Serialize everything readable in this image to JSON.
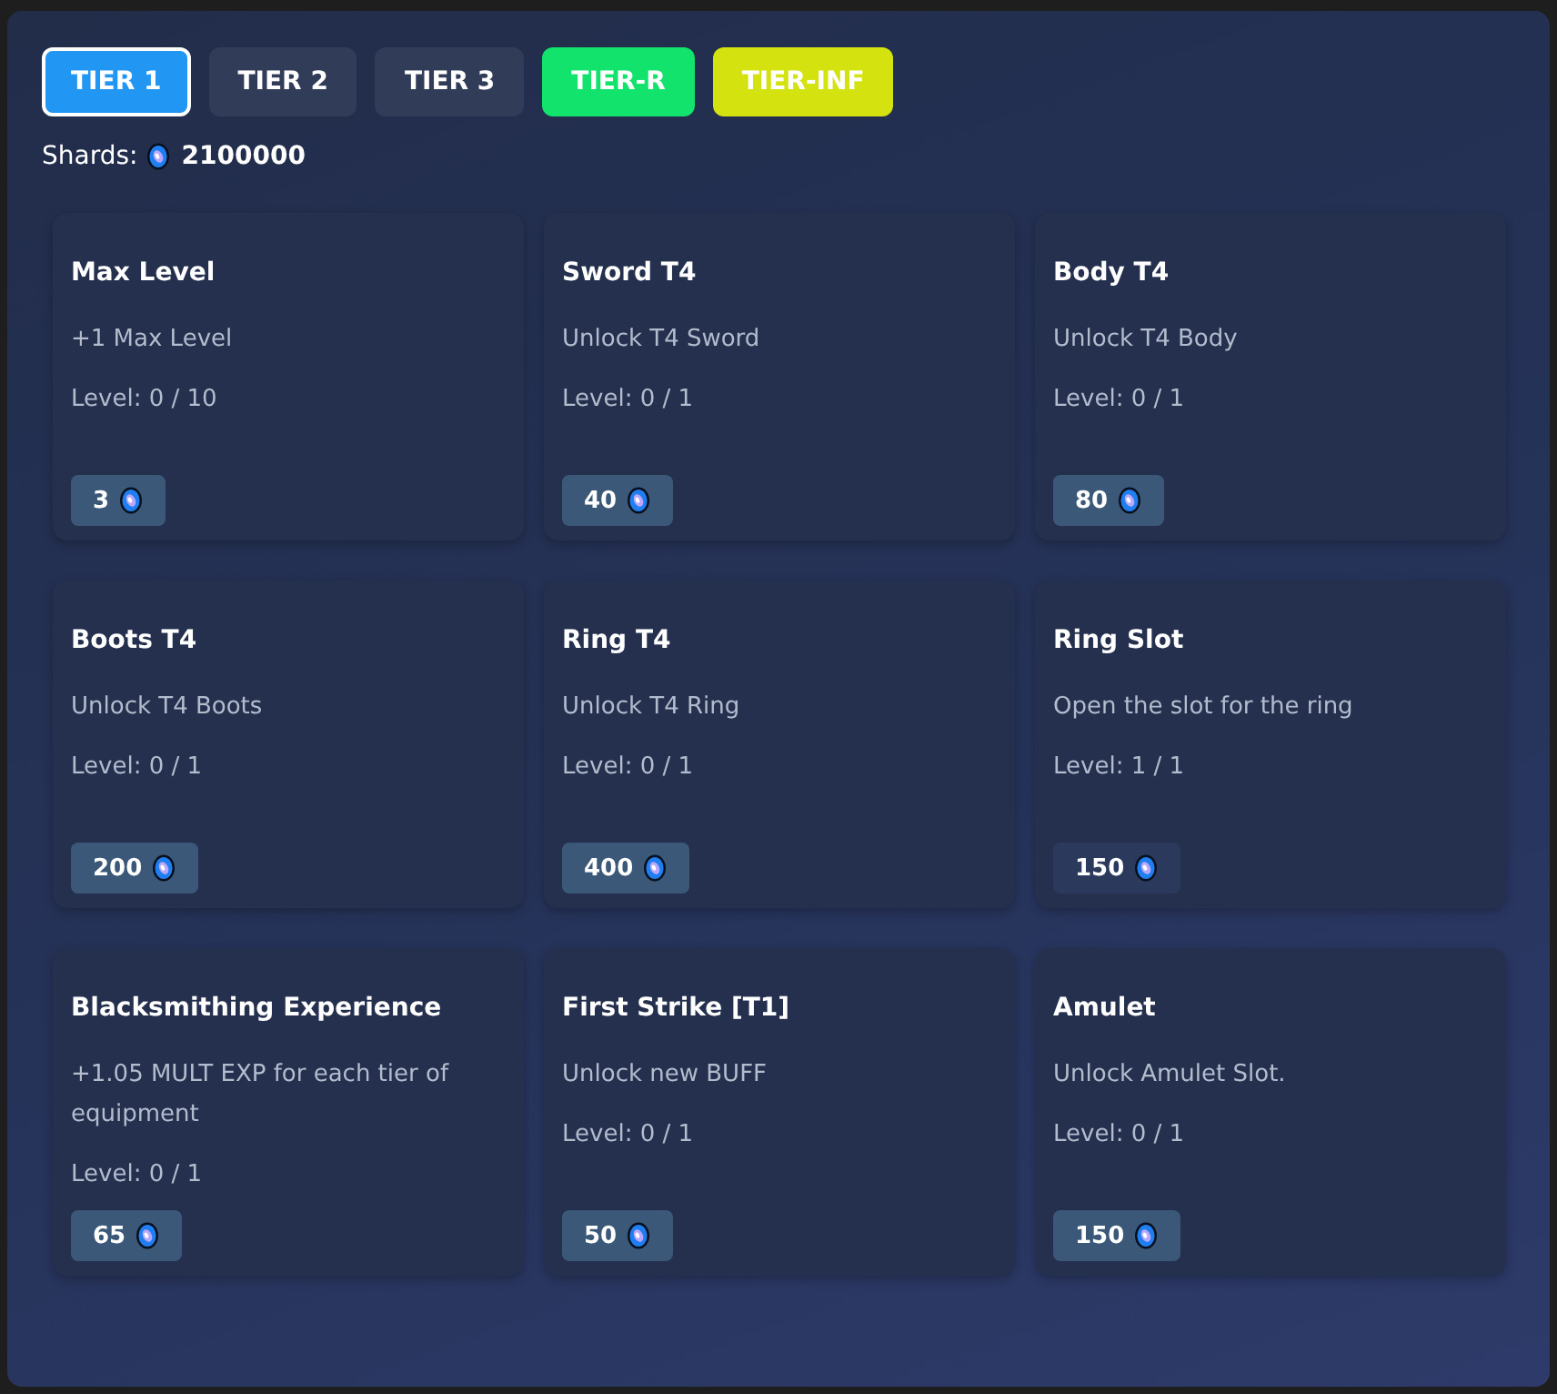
{
  "tabs": [
    {
      "label": "TIER 1",
      "selected": true,
      "color": "#2196f3"
    },
    {
      "label": "TIER 2",
      "selected": false,
      "color": "#303c58"
    },
    {
      "label": "TIER 3",
      "selected": false,
      "color": "#303c58"
    },
    {
      "label": "TIER-R",
      "selected": false,
      "color": "#12e36d"
    },
    {
      "label": "TIER-INF",
      "selected": false,
      "color": "#d4e20f"
    }
  ],
  "shards": {
    "label": "Shards:",
    "value": "2100000"
  },
  "upgrades": [
    {
      "title": "Max Level",
      "description": "+1 Max Level",
      "level": "Level: 0 / 10",
      "cost": "3",
      "disabled": false
    },
    {
      "title": "Sword T4",
      "description": "Unlock T4 Sword",
      "level": "Level: 0 / 1",
      "cost": "40",
      "disabled": false
    },
    {
      "title": "Body T4",
      "description": "Unlock T4 Body",
      "level": "Level: 0 / 1",
      "cost": "80",
      "disabled": false
    },
    {
      "title": "Boots T4",
      "description": "Unlock T4 Boots",
      "level": "Level: 0 / 1",
      "cost": "200",
      "disabled": false
    },
    {
      "title": "Ring T4",
      "description": "Unlock T4 Ring",
      "level": "Level: 0 / 1",
      "cost": "400",
      "disabled": false
    },
    {
      "title": "Ring Slot",
      "description": "Open the slot for the ring",
      "level": "Level: 1 / 1",
      "cost": "150",
      "disabled": true
    },
    {
      "title": "Blacksmithing Experience",
      "description": "+1.05 MULT EXP for each tier of equipment",
      "level": "Level: 0 / 1",
      "cost": "65",
      "disabled": false
    },
    {
      "title": "First Strike [T1]",
      "description": "Unlock new BUFF",
      "level": "Level: 0 / 1",
      "cost": "50",
      "disabled": false
    },
    {
      "title": "Amulet",
      "description": "Unlock Amulet Slot.",
      "level": "Level: 0 / 1",
      "cost": "150",
      "disabled": false
    }
  ]
}
